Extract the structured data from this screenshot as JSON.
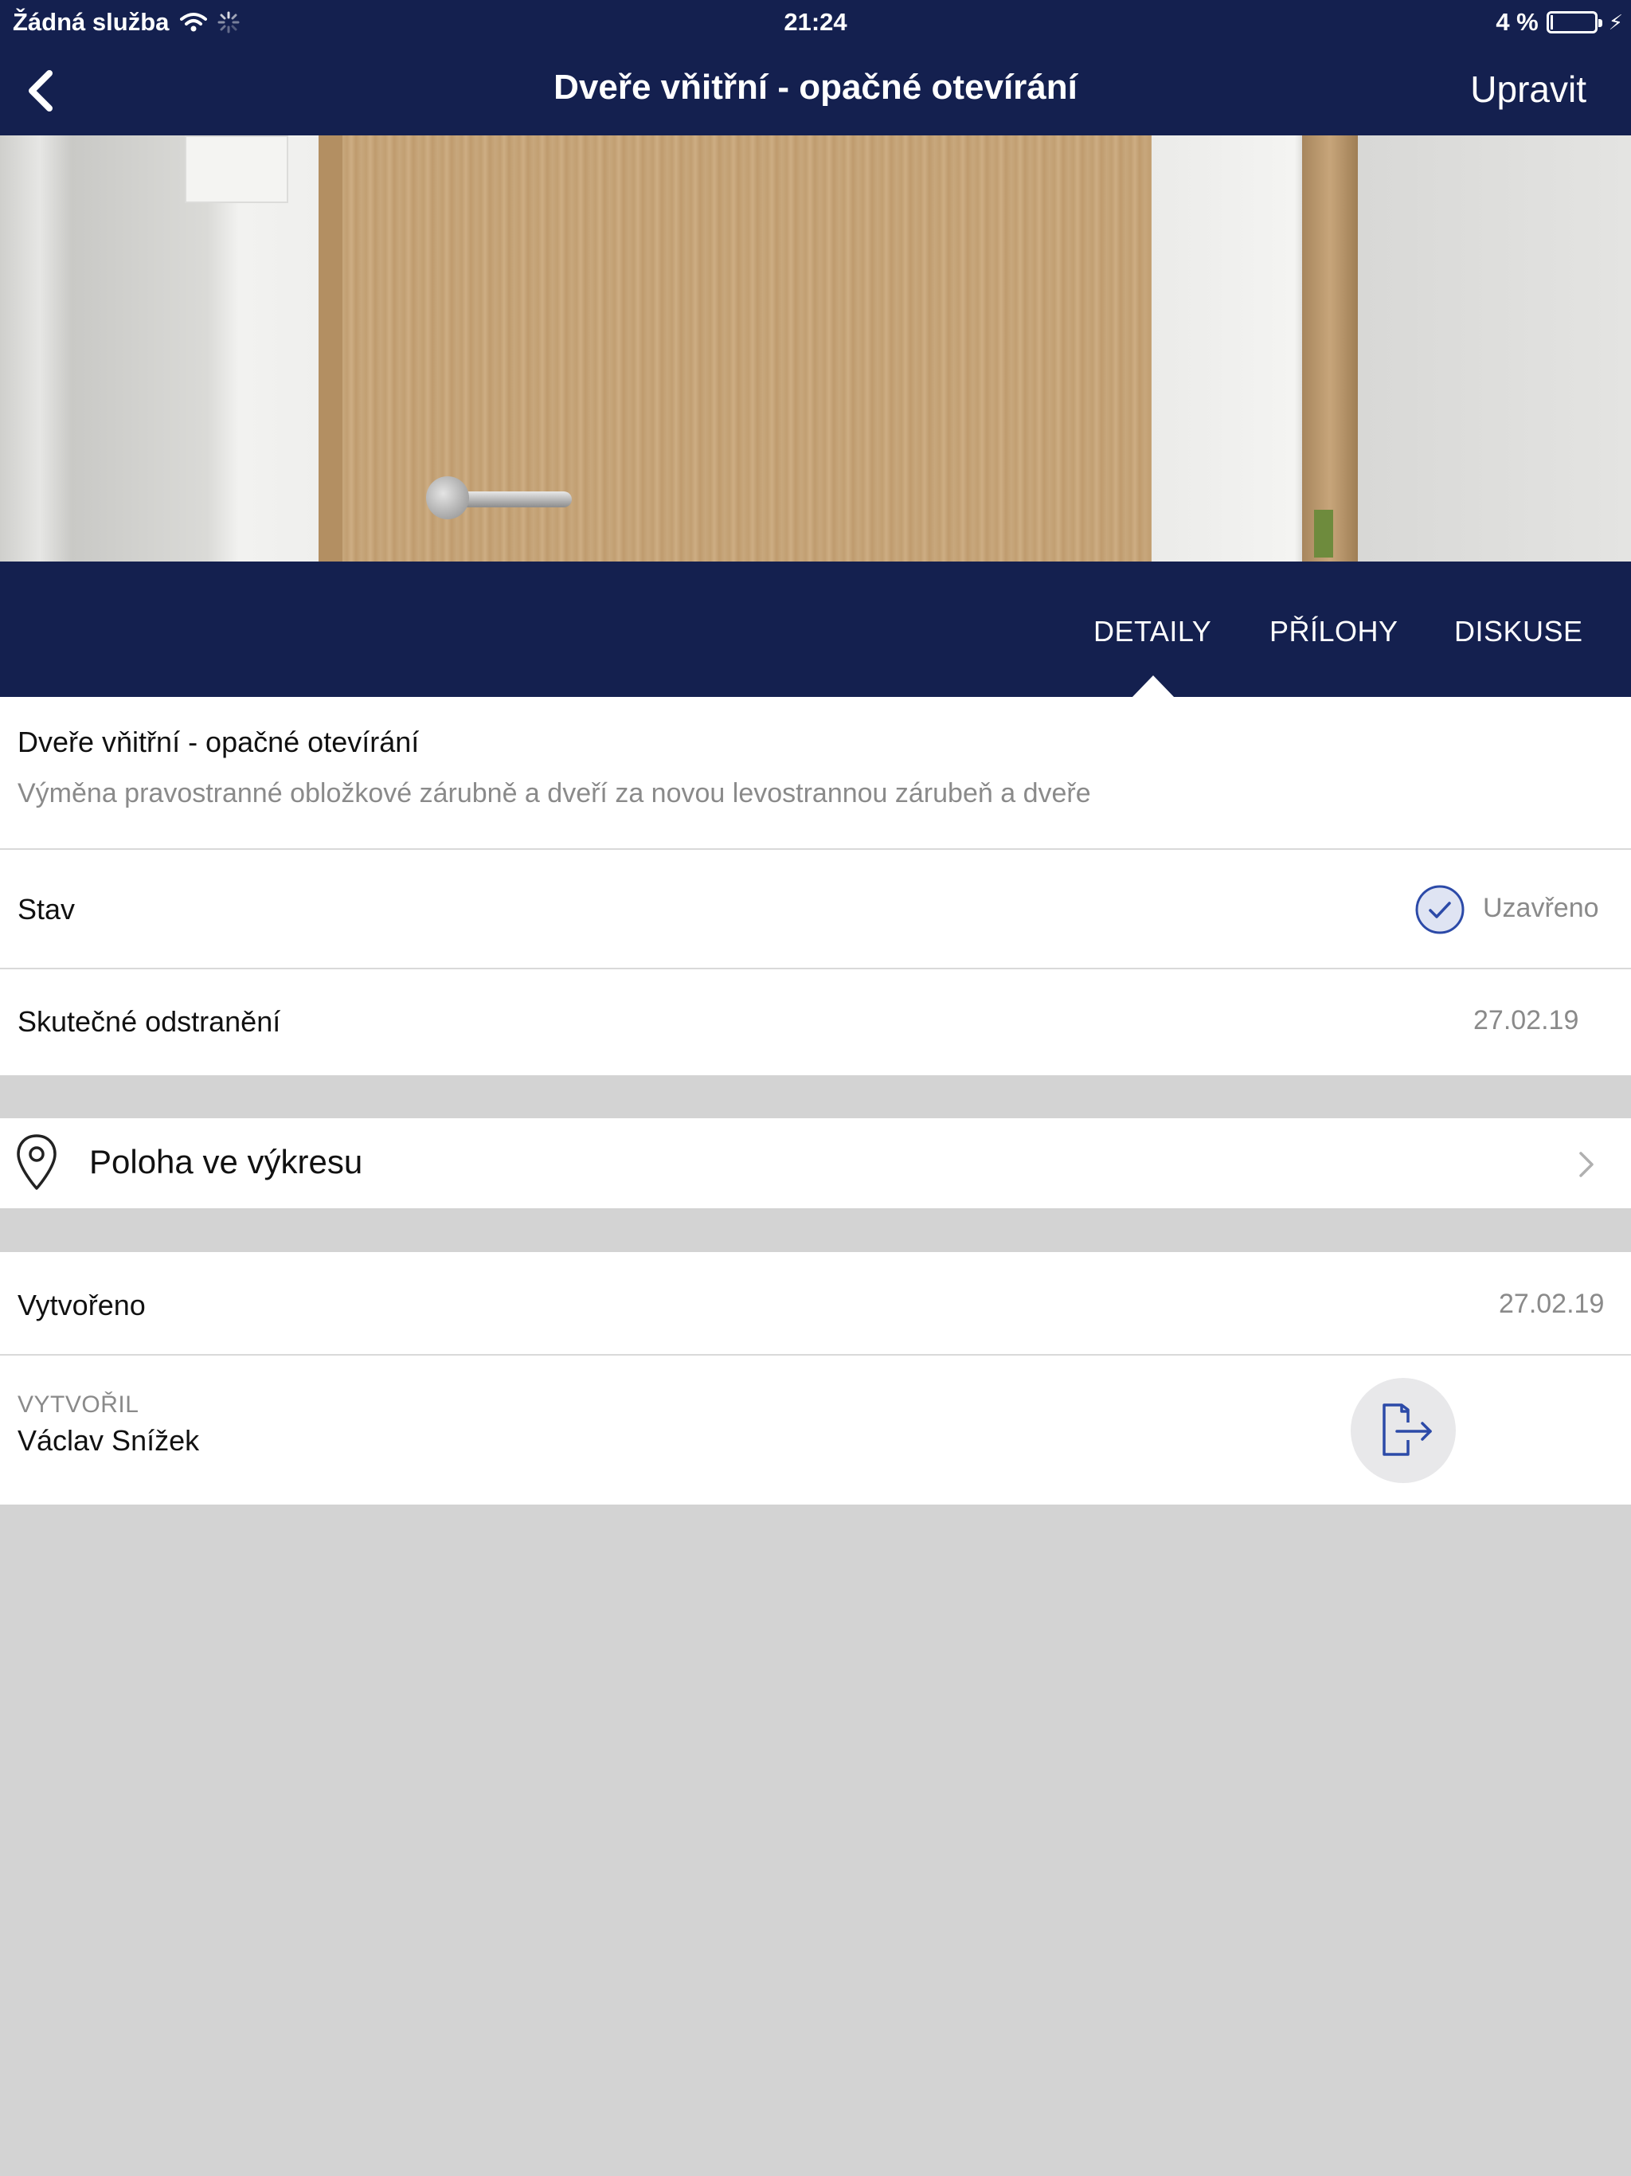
{
  "status_bar": {
    "carrier": "Žádná služba",
    "time": "21:24",
    "battery": "4 %",
    "battery_level_percent": 4
  },
  "nav": {
    "title": "Dveře vňitřní - opačné otevírání",
    "edit_label": "Upravit",
    "back_icon": "chevron-left-icon"
  },
  "tabs": [
    {
      "label": "DETAILY",
      "active": true
    },
    {
      "label": "PŘÍLOHY",
      "active": false
    },
    {
      "label": "DISKUSE",
      "active": false
    }
  ],
  "detail": {
    "title": "Dveře vňitřní - opačné otevírání",
    "description": "Výměna pravostranné obložkové zárubně a dveří za novou levostrannou zárubeň a dveře"
  },
  "status": {
    "label": "Stav",
    "value": "Uzavřeno",
    "icon": "checkmark-circle-icon"
  },
  "removal": {
    "label": "Skutečné odstranění",
    "value": "27.02.19"
  },
  "location": {
    "label": "Poloha ve výkresu",
    "icon": "map-pin-icon"
  },
  "created": {
    "label": "Vytvořeno",
    "value": "27.02.19"
  },
  "creator": {
    "label": "VYTVOŘIL",
    "name": "Václav Snížek",
    "action_icon": "export-icon"
  },
  "colors": {
    "navy": "#14204f",
    "accent": "#2c4aa8",
    "background": "#d3d3d3"
  }
}
